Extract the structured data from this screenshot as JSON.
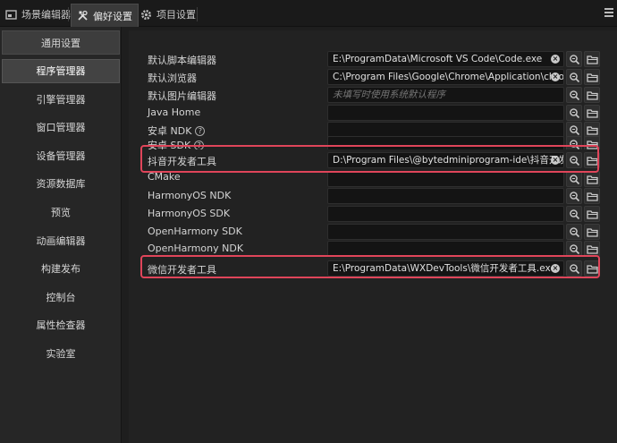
{
  "tabs": [
    {
      "label": "场景编辑器",
      "icon": "scene-icon"
    },
    {
      "label": "偏好设置",
      "icon": "tools-icon"
    },
    {
      "label": "项目设置",
      "icon": "gear-icon"
    }
  ],
  "sidebar": {
    "items": [
      {
        "label": "通用设置"
      },
      {
        "label": "程序管理器"
      },
      {
        "label": "引擎管理器"
      },
      {
        "label": "窗口管理器"
      },
      {
        "label": "设备管理器"
      },
      {
        "label": "资源数据库"
      },
      {
        "label": "预览"
      },
      {
        "label": "动画编辑器"
      },
      {
        "label": "构建发布"
      },
      {
        "label": "控制台"
      },
      {
        "label": "属性检查器"
      },
      {
        "label": "实验室"
      }
    ]
  },
  "settings": {
    "rows": [
      {
        "label": "默认脚本编辑器",
        "value": "E:\\ProgramData\\Microsoft VS Code\\Code.exe",
        "placeholder": ""
      },
      {
        "label": "默认浏览器",
        "value": "C:\\Program Files\\Google\\Chrome\\Application\\chrome.exe",
        "placeholder": ""
      },
      {
        "label": "默认图片编辑器",
        "value": "",
        "placeholder": "未填写时使用系统默认程序"
      },
      {
        "label": "Java Home",
        "value": "",
        "placeholder": ""
      },
      {
        "label": "安卓 NDK",
        "value": "",
        "placeholder": ""
      },
      {
        "label": "安卓 SDK",
        "value": "",
        "placeholder": ""
      },
      {
        "label": "抖音开发者工具",
        "value": "D:\\Program Files\\@bytedminiprogram-ide\\抖音开发者工具.exe",
        "placeholder": ""
      },
      {
        "label": "CMake",
        "value": "",
        "placeholder": ""
      },
      {
        "label": "HarmonyOS NDK",
        "value": "",
        "placeholder": ""
      },
      {
        "label": "HarmonyOS SDK",
        "value": "",
        "placeholder": ""
      },
      {
        "label": "OpenHarmony SDK",
        "value": "",
        "placeholder": ""
      },
      {
        "label": "OpenHarmony NDK",
        "value": "",
        "placeholder": ""
      },
      {
        "label": "微信开发者工具",
        "value": "E:\\ProgramData\\WXDevTools\\微信开发者工具.exe",
        "placeholder": ""
      }
    ]
  },
  "colors": {
    "highlight": "#e0455a",
    "background": "#1e1e1e",
    "sidebar": "#262626"
  }
}
